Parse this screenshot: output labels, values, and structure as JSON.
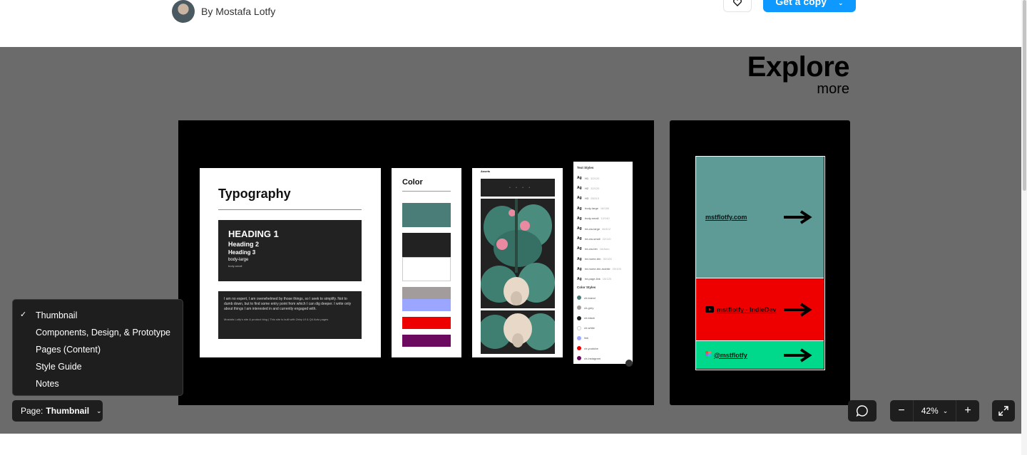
{
  "header": {
    "byline": "By Mostafa Lotfy",
    "copy_button": "Get a copy"
  },
  "canvas": {
    "explore_title": "Explore",
    "explore_subtitle": "more",
    "typography_card": {
      "title": "Typography",
      "heading1": "HEADING 1",
      "heading2": "Heading 2",
      "heading3": "Heading 3",
      "body_large": "body-large",
      "body_small": "body-small",
      "paragraph": "I am no expert, I am overwhelmed by those things, so I seek to simplify. Not to dumb down, but to find some entry point from which I can dig deeper. I write only about things I am interested in and currently engaged with.",
      "footnote": "Mostafa Lotfy's site & product blog | This site is built with Zeby UI & Q4 Auto pages"
    },
    "color_card": {
      "title": "Color",
      "swatches": [
        "#4a7d78",
        "#222222",
        "#ffffff",
        "#a39c9c",
        "#9aa6ff",
        "#ee0000",
        "#6b0a5f"
      ]
    },
    "assets_card": {
      "title": "Assets"
    },
    "styles_card": {
      "text_styles_title": "Text Styles",
      "text_styles": [
        {
          "ag": "Ag",
          "name": "H1",
          "spec": "32/120"
        },
        {
          "ag": "Ag",
          "name": "H2",
          "spec": "32/120"
        },
        {
          "ag": "Ag",
          "name": "H3",
          "spec": "28/110"
        },
        {
          "ag": "Ag",
          "name": "body-large",
          "spec": "16/160"
        },
        {
          "ag": "Ag",
          "name": "body-small",
          "spec": "12/140"
        },
        {
          "ag": "Ag",
          "name": "txt-cta-large",
          "spec": "46/112"
        },
        {
          "ag": "Ag",
          "name": "txt-cta-small",
          "spec": "22/110"
        },
        {
          "ag": "Ag",
          "name": "txt-cta-btn",
          "spec": "16/Auto"
        },
        {
          "ag": "Ag",
          "name": "txt-home-btn",
          "spec": "30/100"
        },
        {
          "ag": "Ag",
          "name": "txt-home-btn-mobile",
          "spec": "20/100"
        },
        {
          "ag": "Ag",
          "name": "txt-page-link",
          "spec": "15/120"
        }
      ],
      "color_styles_title": "Color Styles",
      "color_styles": [
        {
          "name": "clr-brand",
          "color": "#4a7d78"
        },
        {
          "name": "clr-grey",
          "color": "#a39c9c"
        },
        {
          "name": "clr-black",
          "color": "#222222"
        },
        {
          "name": "clr-white",
          "color": "#ffffff"
        },
        {
          "name": "link",
          "color": "#9aa6ff"
        },
        {
          "name": "clr-youtube",
          "color": "#ee0000"
        },
        {
          "name": "clr-instagram",
          "color": "#6b0a5f"
        }
      ]
    },
    "links_card": {
      "links": [
        {
          "text": "mstflotfy.com",
          "bg": "#5e9a96",
          "icon": "none"
        },
        {
          "text": "mstflotfy - IndieDev",
          "bg": "#ee0000",
          "icon": "youtube-icon"
        },
        {
          "text": "@mstflotfy",
          "bg": "#00d98b",
          "icon": "figma-icon"
        }
      ]
    }
  },
  "page_menu": {
    "items": [
      {
        "label": "Thumbnail",
        "checked": true
      },
      {
        "label": "Components, Design, & Prototype",
        "checked": false
      },
      {
        "label": "Pages (Content)",
        "checked": false
      },
      {
        "label": "Style Guide",
        "checked": false
      },
      {
        "label": "Notes",
        "checked": false
      }
    ]
  },
  "page_button": {
    "prefix": "Page:",
    "value": "Thumbnail"
  },
  "zoom": {
    "value": "42%",
    "minus": "−",
    "plus": "+"
  }
}
